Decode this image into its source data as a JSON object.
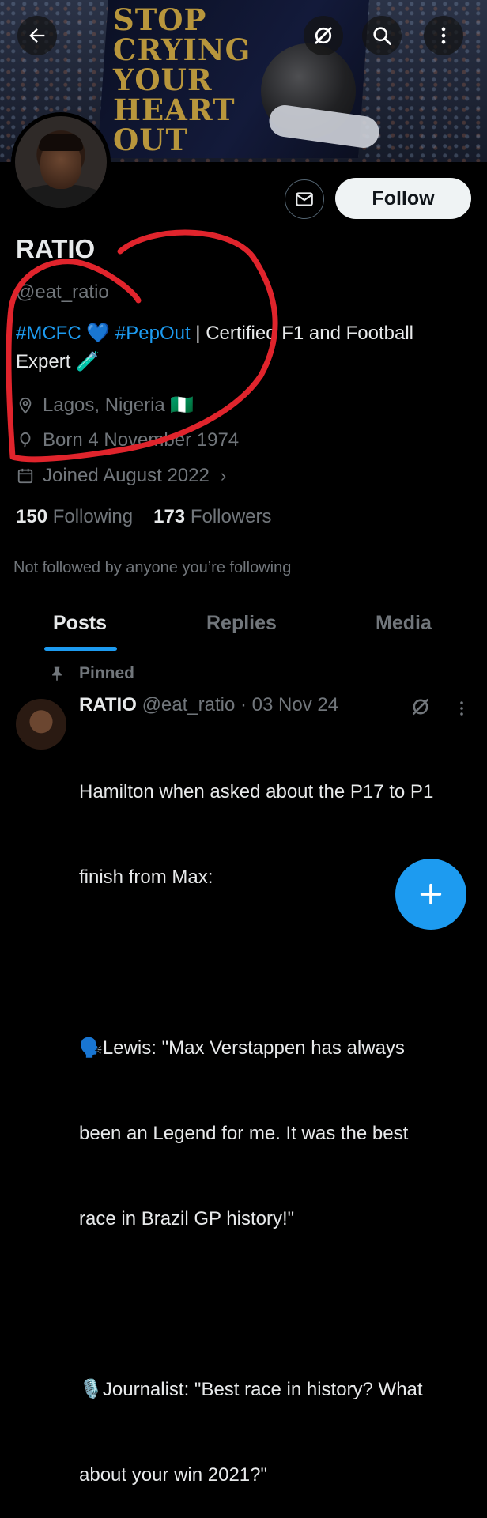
{
  "banner": {
    "tifo_lines": [
      "STOP",
      "CRYING",
      "YOUR",
      "HEART",
      "OUT"
    ]
  },
  "header": {
    "icons": {
      "back": "arrow-left-icon",
      "grok": "grok-icon",
      "search": "search-icon",
      "more": "more-vertical-icon"
    }
  },
  "profile": {
    "follow_label": "Follow",
    "message_icon": "envelope-icon",
    "name": "RATIO",
    "handle": "@eat_ratio",
    "bio": {
      "tag1": "#MCFC",
      "heart": "💙",
      "tag2": "#PepOut",
      "rest": " | Certified F1 and Football",
      "line2": "Expert 🧪"
    },
    "location": "Lagos, Nigeria 🇳🇬",
    "born": "Born 4 November 1974",
    "joined": "Joined August 2022",
    "following_count": "150",
    "following_label": "Following",
    "followers_count": "173",
    "followers_label": "Followers",
    "not_followed": "Not followed by anyone you’re following"
  },
  "tabs": [
    {
      "label": "Posts",
      "active": true
    },
    {
      "label": "Replies",
      "active": false
    },
    {
      "label": "Media",
      "active": false
    }
  ],
  "post": {
    "pinned_label": "Pinned",
    "author_name": "RATIO",
    "author_handle": "@eat_ratio",
    "date": "· 03 Nov 24",
    "lines": [
      "Hamilton when asked about the P17 to P1",
      "finish from Max:",
      "",
      "🗣️Lewis: \"Max Verstappen has always",
      "been an Legend for me. It was the best",
      "race in Brazil GP history!\"",
      "",
      "🎙️Journalist: \"Best race in history? What",
      "about your win 2021?\""
    ]
  },
  "fab": {
    "icon": "plus-icon"
  },
  "colors": {
    "accent": "#1d9bf0",
    "muted": "#71767b",
    "text": "#e7e9ea",
    "annotation": "#e0242c",
    "tifo_gold": "#b8963c"
  }
}
